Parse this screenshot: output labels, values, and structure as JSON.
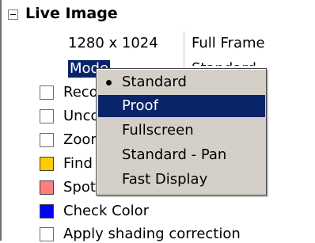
{
  "section": {
    "title": "Live Image"
  },
  "properties": {
    "resolution_key": "1280 x 1024",
    "resolution_value": "Full Frame",
    "mode_key": "Mode",
    "mode_value": "Standard"
  },
  "rows": [
    {
      "label": "Recording",
      "type": "checkbox",
      "checked": false
    },
    {
      "label": "Uncorrected",
      "type": "checkbox",
      "checked": false
    },
    {
      "label": "Zoom",
      "type": "checkbox",
      "checked": false
    },
    {
      "label": "Find",
      "type": "swatch",
      "color": "#ffcc00"
    },
    {
      "label": "Spot",
      "type": "swatch",
      "color": "#ff7f7f"
    },
    {
      "label": "Check Color",
      "type": "swatch",
      "color": "#0000ff"
    },
    {
      "label": "Apply shading correction",
      "type": "checkbox",
      "checked": false
    }
  ],
  "mode_menu": {
    "items": [
      {
        "label": "Standard",
        "selected": true,
        "highlighted": false
      },
      {
        "label": "Proof",
        "selected": false,
        "highlighted": true
      },
      {
        "label": "Fullscreen",
        "selected": false,
        "highlighted": false
      },
      {
        "label": "Standard - Pan",
        "selected": false,
        "highlighted": false
      },
      {
        "label": "Fast Display",
        "selected": false,
        "highlighted": false
      }
    ]
  },
  "colors": {
    "highlight": "#0a246a",
    "menu_bg": "#d4d0c8"
  }
}
